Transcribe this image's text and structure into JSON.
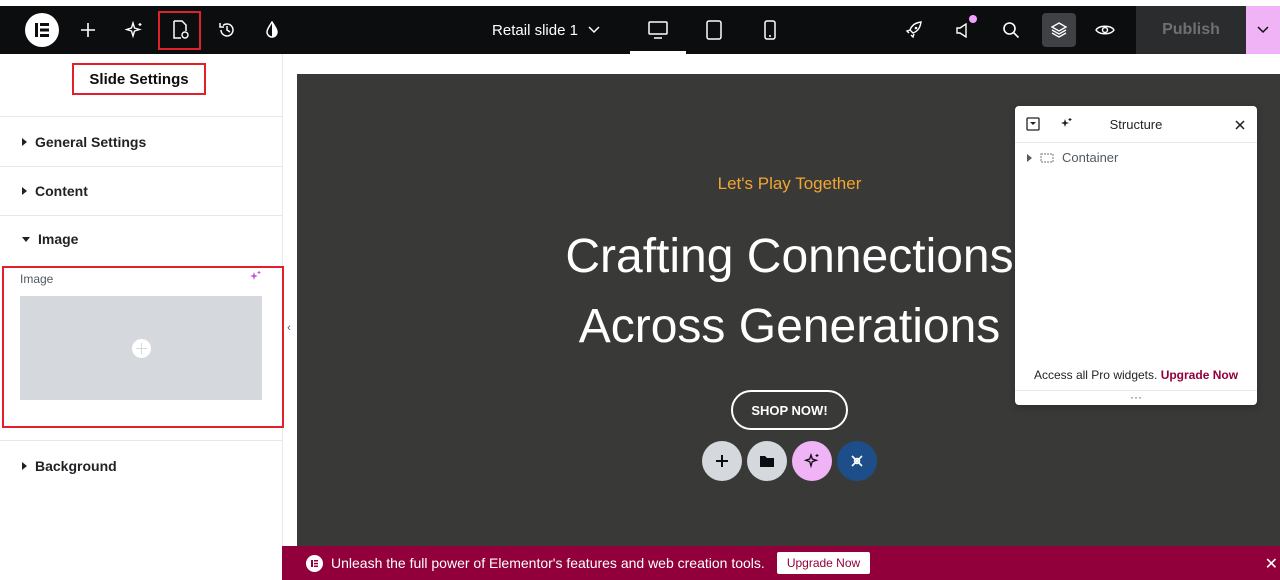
{
  "topbar": {
    "document_title": "Retail slide 1",
    "publish_label": "Publish",
    "icons": [
      "elementor-logo-icon",
      "add-icon",
      "ai-sparkle-icon",
      "page-settings-icon",
      "history-icon",
      "site-settings-icon",
      "chevron-down-icon",
      "desktop-icon",
      "tablet-icon",
      "mobile-icon",
      "rocket-icon",
      "whats-new-icon",
      "search-icon",
      "structure-layers-icon",
      "preview-eye-icon",
      "publish-chevron-icon"
    ],
    "active_device": "desktop"
  },
  "panel": {
    "title": "Slide Settings",
    "sections": [
      {
        "label": "General Settings",
        "expanded": false
      },
      {
        "label": "Content",
        "expanded": false
      },
      {
        "label": "Image",
        "expanded": true
      },
      {
        "label": "Background",
        "expanded": false
      }
    ],
    "image_control_label": "Image"
  },
  "canvas": {
    "tagline": "Let's Play Together",
    "heading_line1": "Crafting Connections",
    "heading_line2": "Across Generations",
    "button_label": "SHOP NOW!"
  },
  "structure": {
    "title": "Structure",
    "item_label": "Container",
    "footer_text": "Access all Pro widgets.",
    "footer_link": "Upgrade Now",
    "dots": "···"
  },
  "banner": {
    "text": "Unleash the full power of Elementor's features and web creation tools.",
    "button_label": "Upgrade Now"
  },
  "colors": {
    "topbar_bg": "#0c0d0e",
    "canvas_bg": "#393a38",
    "accent_orange": "#f2a531",
    "banner_bg": "#92003b",
    "highlight_red": "#e0202a",
    "publish_accent": "#f0b4f6"
  }
}
